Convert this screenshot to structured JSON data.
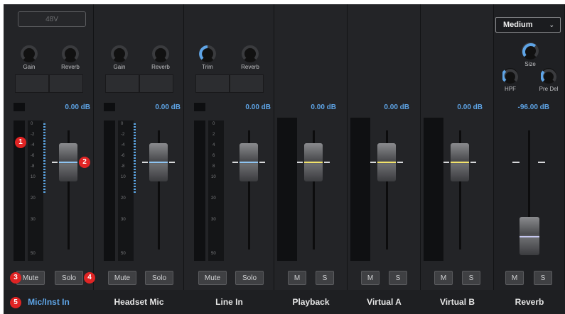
{
  "mic": {
    "phantom_label": "48V",
    "gain_label": "Gain",
    "reverb_label": "Reverb",
    "db": "0.00 dB",
    "scale": [
      "0",
      "-2",
      "-4",
      "-6",
      "-8",
      "10",
      "20",
      "30",
      "50"
    ],
    "mute": "Mute",
    "solo": "Solo",
    "name": "Mic/Inst In"
  },
  "headset": {
    "gain_label": "Gain",
    "reverb_label": "Reverb",
    "db": "0.00 dB",
    "scale": [
      "0",
      "-2",
      "-4",
      "-6",
      "-8",
      "10",
      "20",
      "30",
      "50"
    ],
    "mute": "Mute",
    "solo": "Solo",
    "name": "Headset Mic"
  },
  "line": {
    "trim_label": "Trim",
    "reverb_label": "Reverb",
    "db": "0.00 dB",
    "scale": [
      "0",
      "2",
      "4",
      "6",
      "8",
      "10",
      "20",
      "30",
      "50"
    ],
    "mute": "Mute",
    "solo": "Solo",
    "name": "Line In"
  },
  "playback": {
    "db": "0.00 dB",
    "m": "M",
    "s": "S",
    "name": "Playback"
  },
  "virtual_a": {
    "db": "0.00 dB",
    "m": "M",
    "s": "S",
    "name": "Virtual A"
  },
  "virtual_b": {
    "db": "0.00 dB",
    "m": "M",
    "s": "S",
    "name": "Virtual B"
  },
  "reverb": {
    "size_select": "Medium",
    "size_label": "Size",
    "hpf_label": "HPF",
    "predel_label": "Pre Del",
    "db": "-96.00 dB",
    "m": "M",
    "s": "S",
    "name": "Reverb"
  },
  "badges": [
    "1",
    "2",
    "3",
    "4",
    "5"
  ],
  "colors": {
    "accent_blue": "#5ea4e6",
    "badge_red": "#e02424",
    "fader_line_yellow": "#f2e36a",
    "fader_line_blue": "#8ec4f2"
  }
}
